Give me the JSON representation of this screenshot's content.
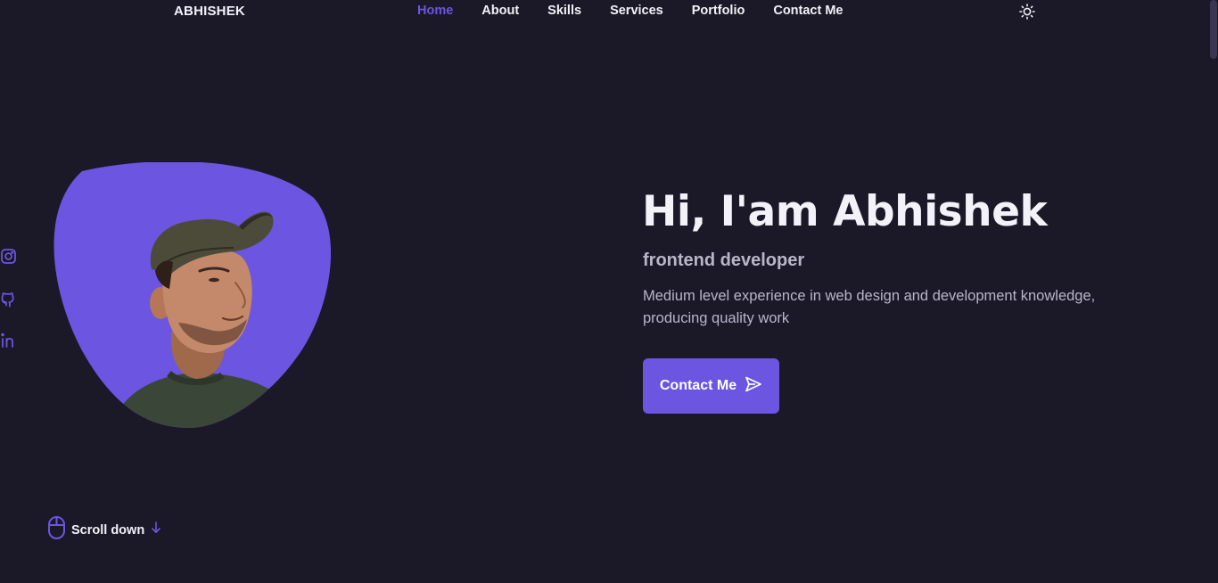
{
  "header": {
    "logo": "ABHISHEK",
    "nav": [
      {
        "label": "Home",
        "active": true
      },
      {
        "label": "About",
        "active": false
      },
      {
        "label": "Skills",
        "active": false
      },
      {
        "label": "Services",
        "active": false
      },
      {
        "label": "Portfolio",
        "active": false
      },
      {
        "label": "Contact Me",
        "active": false
      }
    ],
    "theme_toggle_icon": "sun-icon"
  },
  "social": [
    "instagram-icon",
    "github-icon",
    "linkedin-icon"
  ],
  "hero": {
    "title": "Hi, I'am Abhishek",
    "subtitle": "frontend developer",
    "description": "Medium level experience in web design and development knowledge, producing quality work",
    "button_label": "Contact Me",
    "button_icon": "send-icon"
  },
  "scroll": {
    "label": "Scroll down",
    "icon": "mouse-icon"
  },
  "colors": {
    "background": "#1b1828",
    "accent": "#6c55e0",
    "text": "#f3f2f8",
    "muted_text": "#b9b6c9"
  }
}
